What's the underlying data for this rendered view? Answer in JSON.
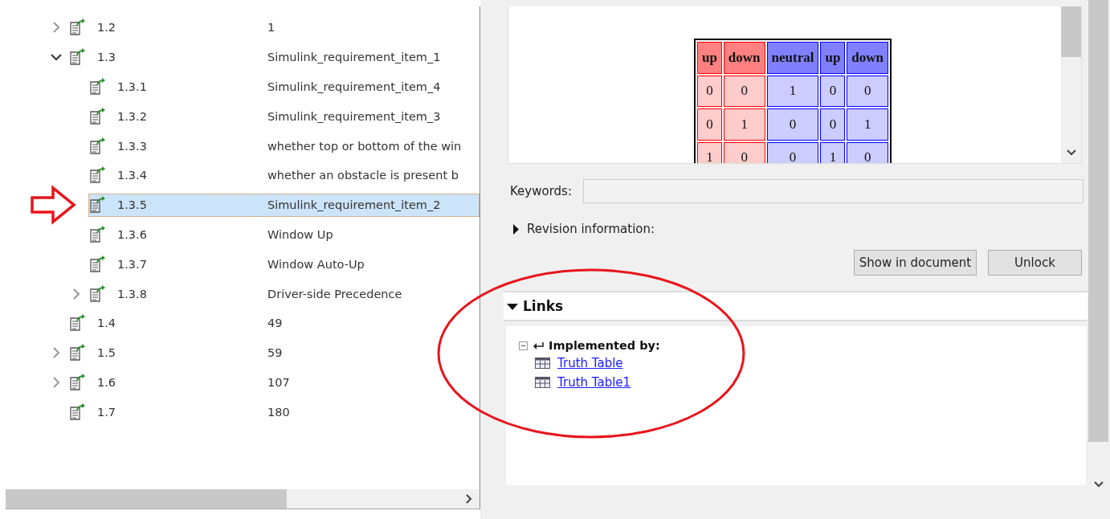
{
  "tree": {
    "items": [
      {
        "number": "1.2",
        "name": "1",
        "kind": "group",
        "expanded": false,
        "selected": false
      },
      {
        "number": "1.3",
        "name": "Simulink_requirement_item_1",
        "kind": "group",
        "expanded": true,
        "selected": false,
        "children": [
          {
            "number": "1.3.1",
            "name": "Simulink_requirement_item_4",
            "kind": "leaf",
            "selected": false
          },
          {
            "number": "1.3.2",
            "name": "Simulink_requirement_item_3",
            "kind": "leaf",
            "selected": false
          },
          {
            "number": "1.3.3",
            "name": "whether top or bottom of the win",
            "kind": "leaf",
            "selected": false
          },
          {
            "number": "1.3.4",
            "name": "whether an obstacle is present b",
            "kind": "leaf",
            "selected": false
          },
          {
            "number": "1.3.5",
            "name": "Simulink_requirement_item_2",
            "kind": "leaf",
            "selected": true
          },
          {
            "number": "1.3.6",
            "name": "Window Up",
            "kind": "leaf",
            "selected": false
          },
          {
            "number": "1.3.7",
            "name": "Window Auto-Up",
            "kind": "leaf",
            "selected": false
          },
          {
            "number": "1.3.8",
            "name": "Driver-side Precedence",
            "kind": "group",
            "expanded": false,
            "selected": false
          }
        ]
      },
      {
        "number": "1.4",
        "name": "49",
        "kind": "leaf",
        "selected": false
      },
      {
        "number": "1.5",
        "name": "59",
        "kind": "group",
        "expanded": false,
        "selected": false
      },
      {
        "number": "1.6",
        "name": "107",
        "kind": "group",
        "expanded": false,
        "selected": false
      },
      {
        "number": "1.7",
        "name": "180",
        "kind": "leaf",
        "selected": false
      }
    ]
  },
  "details": {
    "preview_table": {
      "columns": [
        {
          "label": "up",
          "color": "#ff8080"
        },
        {
          "label": "down",
          "color": "#ff8080"
        },
        {
          "label": "neutral",
          "color": "#8080ff"
        },
        {
          "label": "up",
          "color": "#8080ff"
        },
        {
          "label": "down",
          "color": "#8080ff"
        }
      ],
      "rows": [
        [
          "0",
          "0",
          "1",
          "0",
          "0"
        ],
        [
          "0",
          "1",
          "0",
          "0",
          "1"
        ],
        [
          "1",
          "0",
          "0",
          "1",
          "0"
        ]
      ]
    },
    "keywords": {
      "label": "Keywords:"
    },
    "revision": {
      "label": "Revision information:",
      "expanded": false
    },
    "buttons": [
      "Show in document",
      "Unlock"
    ],
    "links": {
      "title": "Links",
      "expanded": true,
      "groups": [
        {
          "label": "Implemented by:",
          "expanded": true,
          "items": [
            "Truth Table",
            "Truth Table1"
          ]
        }
      ]
    }
  },
  "annotations": {
    "arrow": true,
    "ellipse": true
  }
}
